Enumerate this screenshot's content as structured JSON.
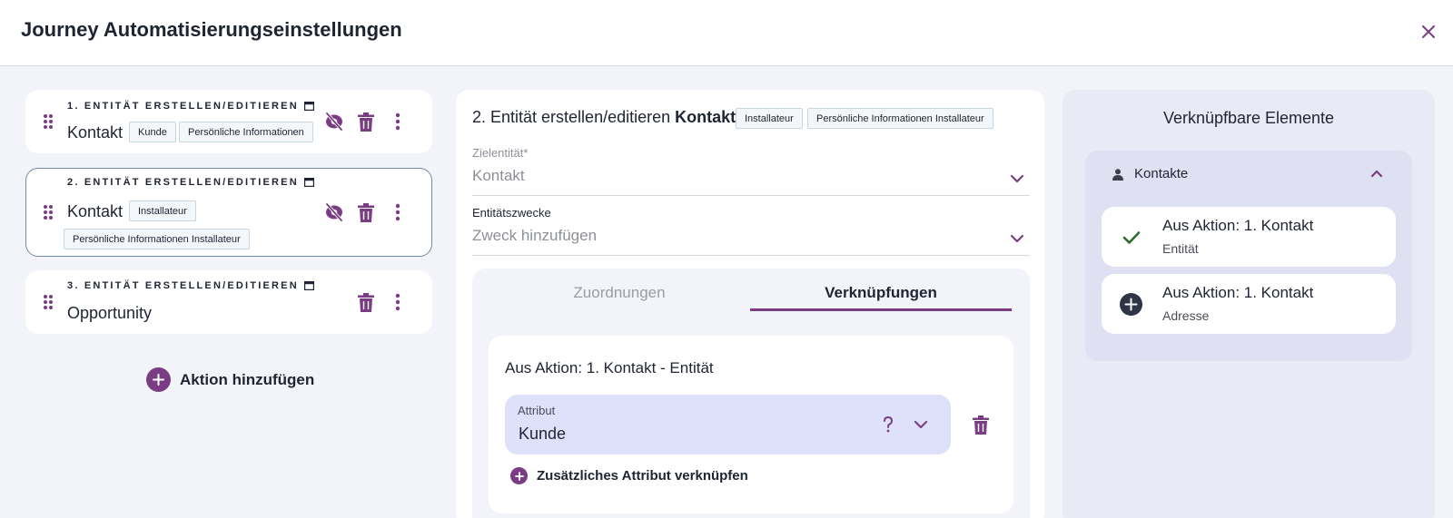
{
  "header": {
    "title": "Journey Automatisierungseinstellungen"
  },
  "actions": [
    {
      "step": "1. ENTITÄT ERSTELLEN/EDITIEREN",
      "name": "Kontakt",
      "tags": [
        "Kunde",
        "Persönliche Informationen"
      ]
    },
    {
      "step": "2. ENTITÄT ERSTELLEN/EDITIEREN",
      "name": "Kontakt",
      "tags": [
        "Installateur",
        "Persönliche Informationen Installateur"
      ]
    },
    {
      "step": "3. ENTITÄT ERSTELLEN/EDITIEREN",
      "name": "Opportunity",
      "tags": []
    }
  ],
  "add_action_label": "Aktion hinzufügen",
  "detail": {
    "title_prefix": "2. Entität erstellen/editieren",
    "title_entity": "Kontakt",
    "tags": [
      "Installateur",
      "Persönliche Informationen Installateur"
    ],
    "target_entity": {
      "label": "Zielentität*",
      "value": "Kontakt"
    },
    "purposes": {
      "label": "Entitätszwecke",
      "placeholder": "Zweck hinzufügen"
    },
    "tabs": [
      "Zuordnungen",
      "Verknüpfungen"
    ],
    "active_tab": 1,
    "link": {
      "title": "Aus Aktion: 1. Kontakt - Entität",
      "attribute_label": "Attribut",
      "attribute_value": "Kunde",
      "add_attribute_label": "Zusätzliches Attribut verknüpfen"
    }
  },
  "linkable": {
    "title": "Verknüpfbare Elemente",
    "group": "Kontakte",
    "items": [
      {
        "title": "Aus Aktion: 1. Kontakt",
        "subtitle": "Entität",
        "state": "linked"
      },
      {
        "title": "Aus Aktion: 1. Kontakt",
        "subtitle": "Adresse",
        "state": "add"
      }
    ]
  },
  "colors": {
    "accent": "#7a3d83",
    "text": "#1f2433",
    "check": "#2f6b2a",
    "attribute_bg": "#dfe1fb"
  }
}
